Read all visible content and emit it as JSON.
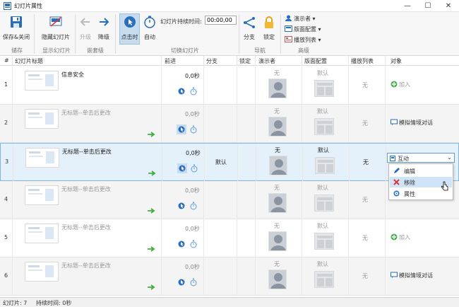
{
  "window": {
    "title": "幻灯片属性",
    "minimize": "—",
    "maximize": "☐",
    "close": "✕"
  },
  "ribbon": {
    "save_close": "保存&关闭",
    "hide_slide": "隐藏幻灯片",
    "promote": "升级",
    "demote": "降级",
    "on_click": "点击时",
    "auto": "自动",
    "duration_label": "幻灯片持续时间:",
    "duration_value": "00:00,00",
    "branch": "分支",
    "lock": "锁定",
    "presenter": "演示者 ▾",
    "layout": "版面配置 ▾",
    "playlist": "播放列表 ▾",
    "groups": {
      "save": "储存",
      "show": "显示幻灯片",
      "nest": "嵌套级",
      "transition": "切换幻灯片",
      "nav": "导航",
      "advanced": "高级"
    }
  },
  "table": {
    "headers": {
      "num": "#",
      "title": "幻灯片标题",
      "advance": "前进",
      "branch": "分支",
      "lock": "锁定",
      "presenter": "演示者",
      "layout": "版面配置",
      "playlist": "播放列表",
      "object": "对象"
    },
    "rows": [
      {
        "num": "1",
        "title": "信息安全",
        "time": "0,0秒",
        "branch": "",
        "presenter": "无",
        "layout": "默认",
        "playlist": "无",
        "object": "加入"
      },
      {
        "num": "2",
        "title": "无标题--单击后更改",
        "time": "0,0秒",
        "branch": "",
        "presenter": "无",
        "layout": "默认",
        "playlist": "无",
        "object": "模拟情境对话"
      },
      {
        "num": "3",
        "title": "无标题--单击后更改",
        "time": "0,0秒",
        "branch": "默认",
        "presenter": "无",
        "layout": "默认",
        "playlist": "无",
        "object": ""
      },
      {
        "num": "4",
        "title": "无标题--单击后更改",
        "time": "0,0秒",
        "branch": "",
        "presenter": "无",
        "layout": "默认",
        "playlist": "无",
        "object": ""
      },
      {
        "num": "5",
        "title": "无标题--单击后更改",
        "time": "0,0秒",
        "branch": "",
        "presenter": "无",
        "layout": "默认",
        "playlist": "无",
        "object": "加入"
      },
      {
        "num": "6",
        "title": "无标题--单击后更改",
        "time": "0,0秒",
        "branch": "",
        "presenter": "无",
        "layout": "默认",
        "playlist": "无",
        "object": "模拟情境对话"
      }
    ],
    "branch_default": "默认"
  },
  "dropdown": {
    "selected": "互动",
    "items": [
      "编辑",
      "移除",
      "属性"
    ]
  },
  "status": {
    "slides": "幻灯片: 7",
    "duration": "持续时间: 0秒"
  },
  "colors": {
    "accent": "#2a6ebb",
    "selected_row": "#e4f1fb",
    "green_arrow": "#3fae3f",
    "hover_item": "#cfe4f7"
  }
}
